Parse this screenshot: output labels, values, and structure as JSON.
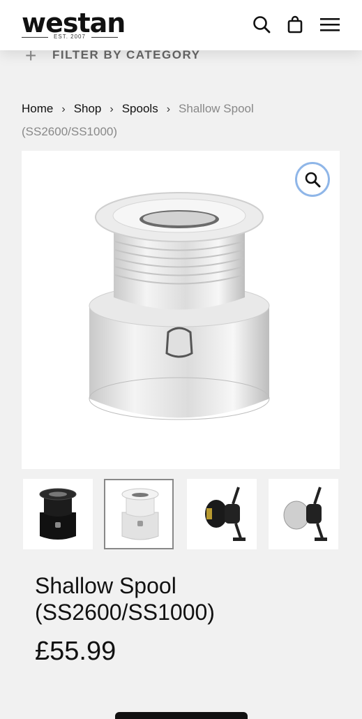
{
  "header": {
    "logo_text": "westan",
    "logo_sub": "EST. 2007",
    "icons": [
      "search-icon",
      "shopping-bag-icon",
      "menu-icon"
    ]
  },
  "filter": {
    "label": "FILTER BY CATEGORY",
    "icon": "plus-icon"
  },
  "breadcrumb": {
    "items": [
      "Home",
      "Shop",
      "Spools"
    ],
    "current": "Shallow Spool (SS2600/SS1000)",
    "separator_icon": "chevron-right-icon"
  },
  "gallery": {
    "zoom_icon": "magnifier-icon",
    "thumbnails": [
      "black-spool",
      "silver-spool",
      "reel-black",
      "reel-silver"
    ],
    "active_index": 1
  },
  "product": {
    "title": "Shallow Spool (SS2600/SS1000)",
    "price": "£55.99"
  },
  "colors": {
    "background": "#f1f1f1",
    "header": "#ffffff",
    "zoom_ring": "#8fb6e8"
  }
}
